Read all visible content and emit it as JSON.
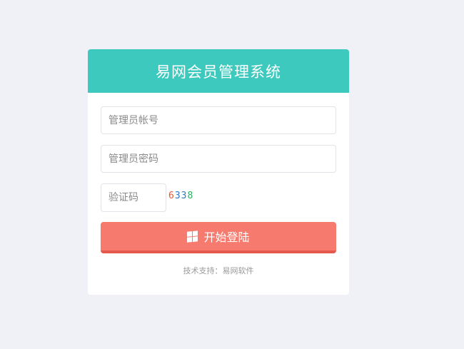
{
  "header": {
    "title": "易网会员管理系统"
  },
  "form": {
    "account_placeholder": "管理员帐号",
    "password_placeholder": "管理员密码",
    "captcha_placeholder": "验证码",
    "captcha_chars": [
      {
        "char": "6",
        "color": "#e8572a"
      },
      {
        "char": "3",
        "color": "#2b78c5"
      },
      {
        "char": "3",
        "color": "#2b78c5"
      },
      {
        "char": "8",
        "color": "#2fae66"
      }
    ],
    "login_label": "开始登陆"
  },
  "footer": {
    "text": "技术支持：易网软件"
  },
  "colors": {
    "header_bg": "#3dc9be",
    "button_bg": "#f77a6e",
    "button_shadow": "#e5584c",
    "page_bg": "#f0f1f6"
  },
  "icons": {
    "login_icon": "windows-icon"
  }
}
